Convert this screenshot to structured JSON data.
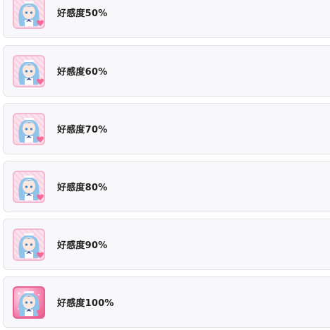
{
  "items": [
    {
      "label": "好感度50%",
      "icon": "affection-50-icon"
    },
    {
      "label": "好感度60%",
      "icon": "affection-60-icon"
    },
    {
      "label": "好感度70%",
      "icon": "affection-70-icon"
    },
    {
      "label": "好感度80%",
      "icon": "affection-80-icon"
    },
    {
      "label": "好感度90%",
      "icon": "affection-90-icon"
    },
    {
      "label": "好感度100%",
      "icon": "affection-100-icon"
    }
  ],
  "colors": {
    "row_background": "#f8f8fb",
    "row_border": "#e2e2e8",
    "hair": "#8fc4ea",
    "heart_badge": "#f26b9a"
  }
}
